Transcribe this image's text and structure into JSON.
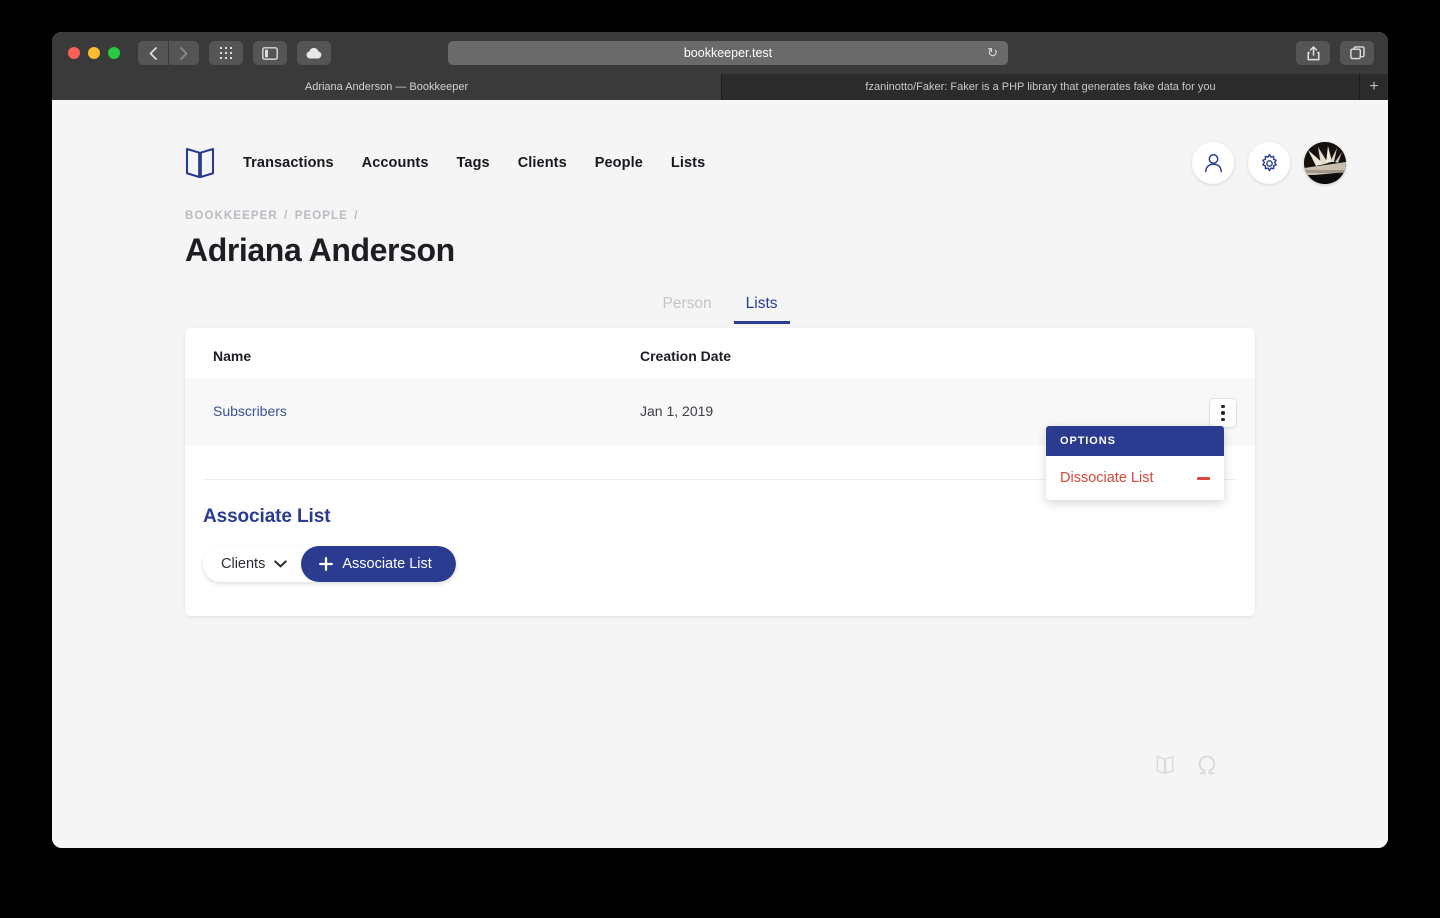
{
  "browser": {
    "url": "bookkeeper.test",
    "reload_icon": "reload-icon",
    "back_icon": "chevron-left-icon",
    "forward_icon": "chevron-right-icon",
    "grid_icon": "grid-icon",
    "sidebar_icon": "sidebar-icon",
    "cloud_icon": "cloud-icon",
    "share_icon": "share-icon",
    "tabs_icon": "new-window-icon",
    "new_tab_label": "+",
    "tabs": [
      {
        "title": "Adriana Anderson — Bookkeeper",
        "active": true
      },
      {
        "title": "fzaninotto/Faker: Faker is a PHP library that generates fake data for you",
        "active": false
      }
    ]
  },
  "header": {
    "logo_icon": "book-logo-icon",
    "nav": [
      {
        "label": "Transactions"
      },
      {
        "label": "Accounts"
      },
      {
        "label": "Tags"
      },
      {
        "label": "Clients"
      },
      {
        "label": "People"
      },
      {
        "label": "Lists"
      }
    ],
    "actions": {
      "person_icon": "person-icon",
      "settings_icon": "gear-icon",
      "avatar": "user-avatar"
    }
  },
  "breadcrumb": {
    "items": [
      "BOOKKEEPER",
      "PEOPLE"
    ],
    "separator": "/",
    "trailing": "/"
  },
  "page": {
    "title": "Adriana Anderson"
  },
  "tabs": [
    {
      "label": "Person",
      "active": false
    },
    {
      "label": "Lists",
      "active": true
    }
  ],
  "table": {
    "columns": [
      "Name",
      "Creation Date"
    ],
    "rows": [
      {
        "name": "Subscribers",
        "creation_date": "Jan 1, 2019",
        "menu_icon": "kebab-menu-icon"
      }
    ]
  },
  "options_menu": {
    "header": "OPTIONS",
    "items": [
      {
        "label": "Dissociate List",
        "icon": "minus-icon",
        "color": "#d7483c"
      }
    ]
  },
  "associate": {
    "title": "Associate List",
    "select_value": "Clients",
    "select_icon": "chevron-down-icon",
    "button_label": "Associate List",
    "button_icon": "plus-icon"
  },
  "footer": {
    "icons": [
      "book-icon",
      "omega-icon"
    ]
  },
  "colors": {
    "navy": "#2b3b8f",
    "danger": "#d7483c",
    "link": "#3d5199",
    "muted": "#b9bcc2",
    "page_bg": "#f5f5f5"
  }
}
